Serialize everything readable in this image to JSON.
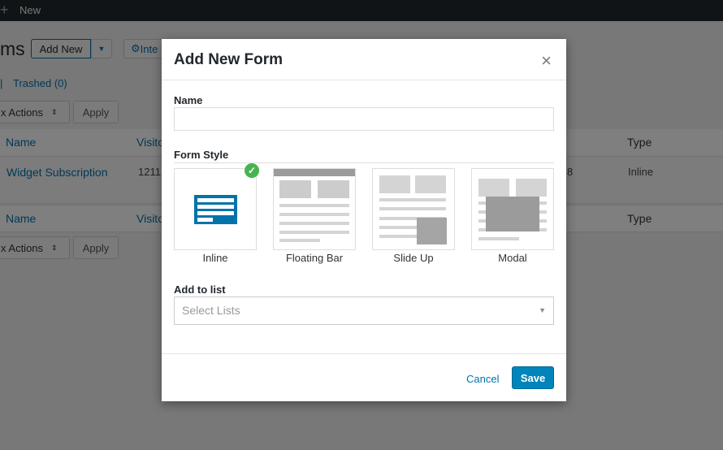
{
  "adminbar": {
    "new_label": "New"
  },
  "page": {
    "title_fragment": "ms",
    "add_new": "Add New",
    "integrations": "Inte",
    "trashed": "Trashed (0)",
    "bulk_actions": "x Actions",
    "apply": "Apply",
    "columns": {
      "name": "Name",
      "visitors": "Visito",
      "type": "Type"
    },
    "rows": [
      {
        "name": "Widget Subscription",
        "visitors": "1211",
        "other": "8",
        "type": "Inline"
      }
    ]
  },
  "modal": {
    "title": "Add New Form",
    "name_label": "Name",
    "name_value": "",
    "form_style_label": "Form Style",
    "styles": [
      {
        "label": "Inline",
        "selected": true
      },
      {
        "label": "Floating Bar",
        "selected": false
      },
      {
        "label": "Slide Up",
        "selected": false
      },
      {
        "label": "Modal",
        "selected": false
      }
    ],
    "list_label": "Add to list",
    "list_placeholder": "Select Lists",
    "cancel": "Cancel",
    "save": "Save"
  },
  "colors": {
    "accent": "#0073aa",
    "check": "#46b450"
  }
}
